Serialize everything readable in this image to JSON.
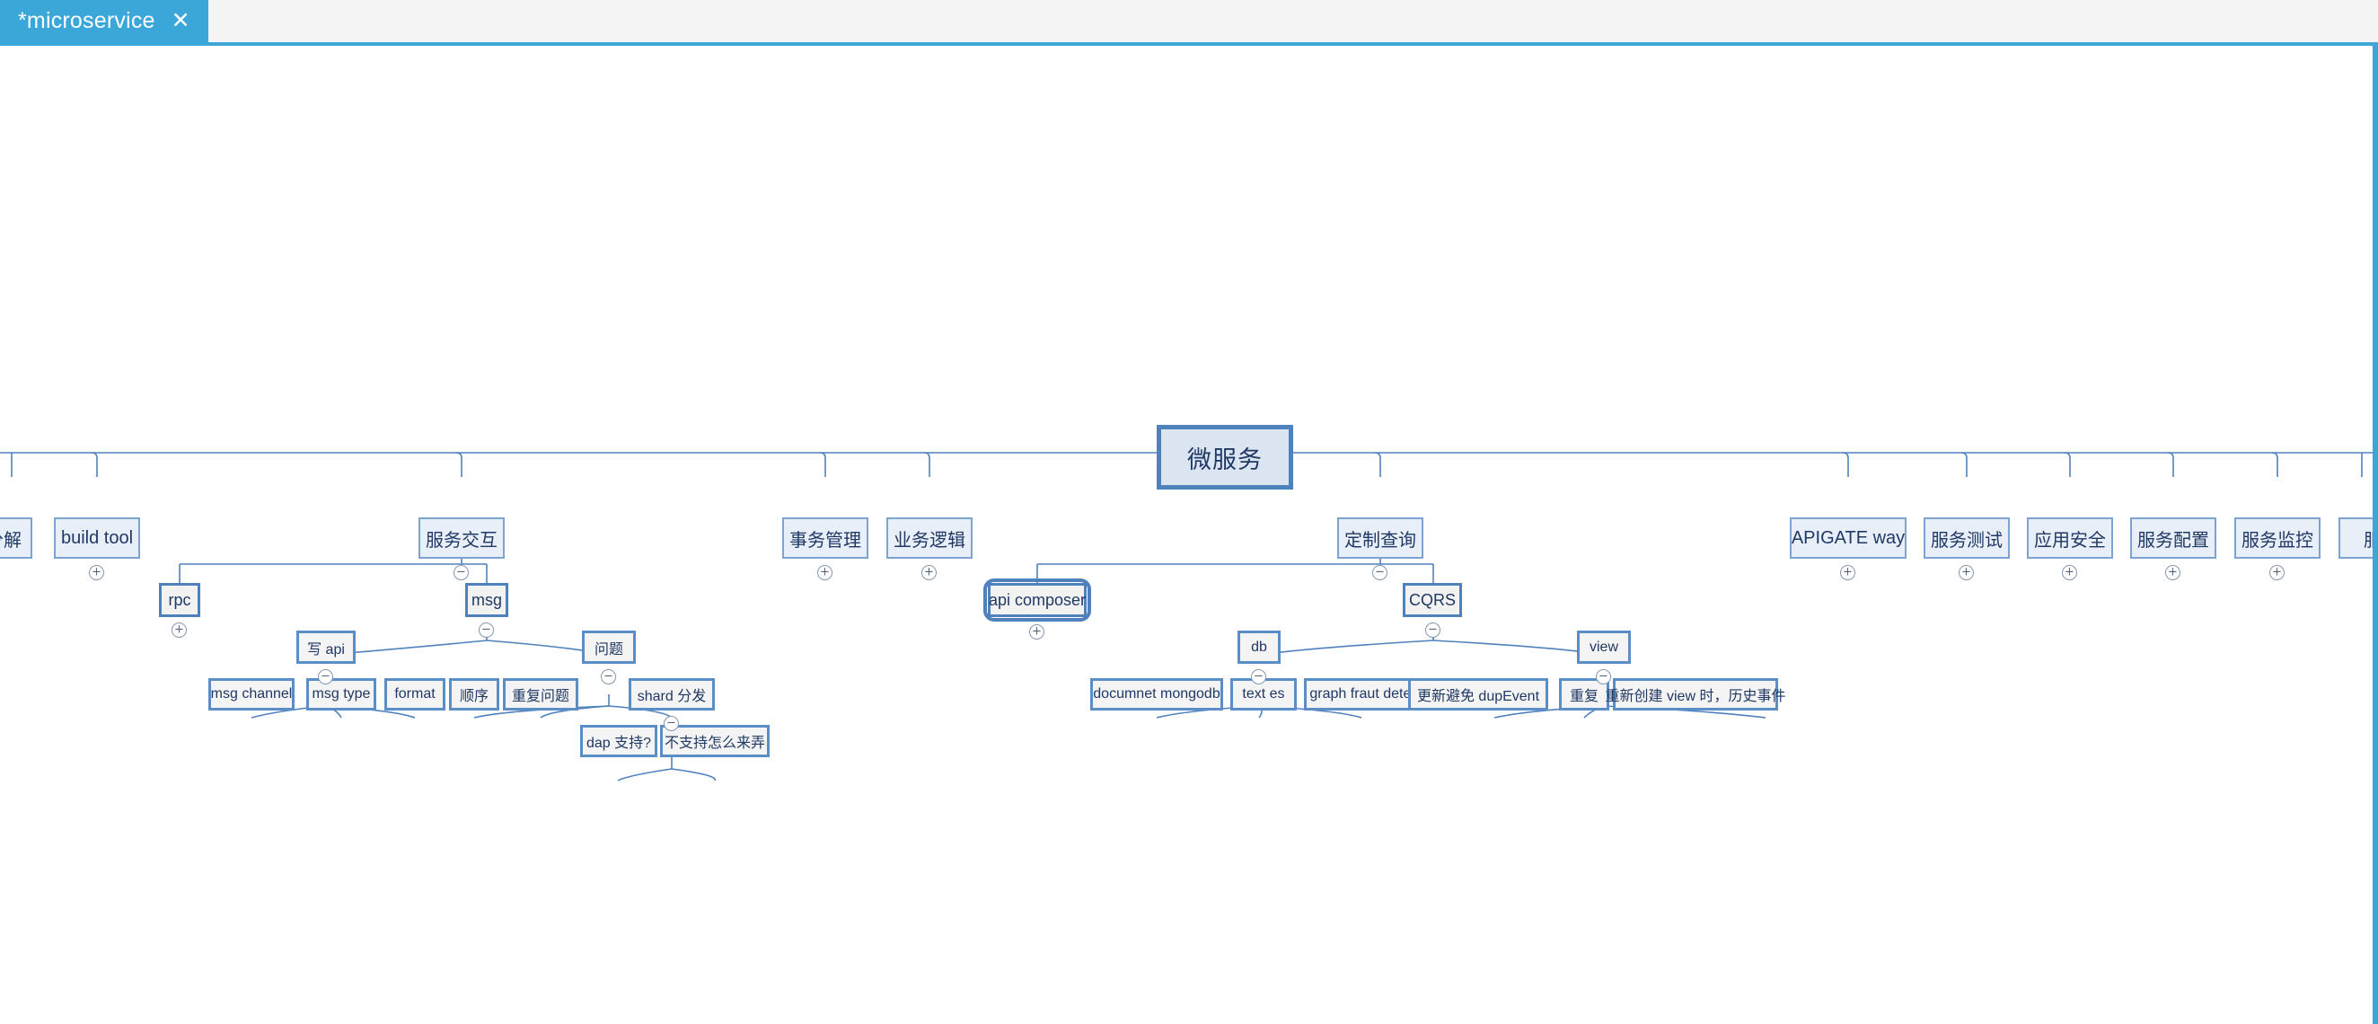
{
  "window": {
    "accent_color": "#3ba7d8",
    "canvas_background": "#ffffff",
    "node_border_color": "#4f81bd",
    "node_fill_color": "#f2f2f2",
    "root_fill_color": "#dbe5f1",
    "text_color": "#1f3864"
  },
  "tab": {
    "title": "*microservice",
    "close_label": "✕"
  },
  "toggles": {
    "expand": "+",
    "collapse": "−"
  },
  "mindmap": {
    "root": {
      "label": "微服务"
    },
    "level2": [
      {
        "id": "fenjie",
        "label": "分解",
        "toggle": "none",
        "clipped": true
      },
      {
        "id": "build-tool",
        "label": "build tool",
        "toggle": "expand"
      },
      {
        "id": "fuwu-jiaohu",
        "label": "服务交互",
        "toggle": "collapse"
      },
      {
        "id": "shiwu-guanli",
        "label": "事务管理",
        "toggle": "expand"
      },
      {
        "id": "yewu-luoji",
        "label": "业务逻辑",
        "toggle": "expand"
      },
      {
        "id": "dingzhi-chaxun",
        "label": "定制查询",
        "toggle": "collapse"
      },
      {
        "id": "apigateway",
        "label": "APIGATE way",
        "toggle": "expand"
      },
      {
        "id": "fuwu-ceshi",
        "label": "服务测试",
        "toggle": "expand"
      },
      {
        "id": "yingyong-anquan",
        "label": "应用安全",
        "toggle": "expand"
      },
      {
        "id": "fuwu-peizhi",
        "label": "服务配置",
        "toggle": "expand"
      },
      {
        "id": "fuwu-jiankong",
        "label": "服务监控",
        "toggle": "expand"
      },
      {
        "id": "fuwu-clipped",
        "label": "服务",
        "toggle": "none",
        "clipped": true
      }
    ],
    "level3": [
      {
        "id": "rpc",
        "label": "rpc",
        "toggle": "expand"
      },
      {
        "id": "msg",
        "label": "msg",
        "toggle": "collapse"
      },
      {
        "id": "api-composer",
        "label": "api composer",
        "toggle": "expand",
        "selected": true
      },
      {
        "id": "cqrs",
        "label": "CQRS",
        "toggle": "collapse"
      }
    ],
    "level4": [
      {
        "id": "xie-api",
        "label": "写 api",
        "toggle": "collapse"
      },
      {
        "id": "wenti",
        "label": "问题",
        "toggle": "collapse"
      },
      {
        "id": "db",
        "label": "db",
        "toggle": "collapse"
      },
      {
        "id": "view",
        "label": "view",
        "toggle": "collapse"
      }
    ],
    "level5": [
      {
        "id": "msg-channel",
        "label": "msg channel"
      },
      {
        "id": "msg-type",
        "label": "msg type"
      },
      {
        "id": "format",
        "label": "format"
      },
      {
        "id": "shunxu",
        "label": "顺序"
      },
      {
        "id": "chongfu-wenti",
        "label": "重复问题"
      },
      {
        "id": "shard-fenfa",
        "label": "shard 分发",
        "toggle": "collapse"
      },
      {
        "id": "documnet-mongodb",
        "label": "documnet mongodb"
      },
      {
        "id": "text-es",
        "label": "text es"
      },
      {
        "id": "graph-fraut",
        "label": "graph fraut detected"
      },
      {
        "id": "gengxin-dup",
        "label": "更新避免 dupEvent"
      },
      {
        "id": "chongfu",
        "label": "重复"
      },
      {
        "id": "chongxin-view",
        "label": "重新创建 view 时，历史事件"
      }
    ],
    "level6": [
      {
        "id": "dap-zhichi",
        "label": "dap 支持?"
      },
      {
        "id": "buzhichi-nong",
        "label": "不支持怎么来弄"
      }
    ]
  }
}
